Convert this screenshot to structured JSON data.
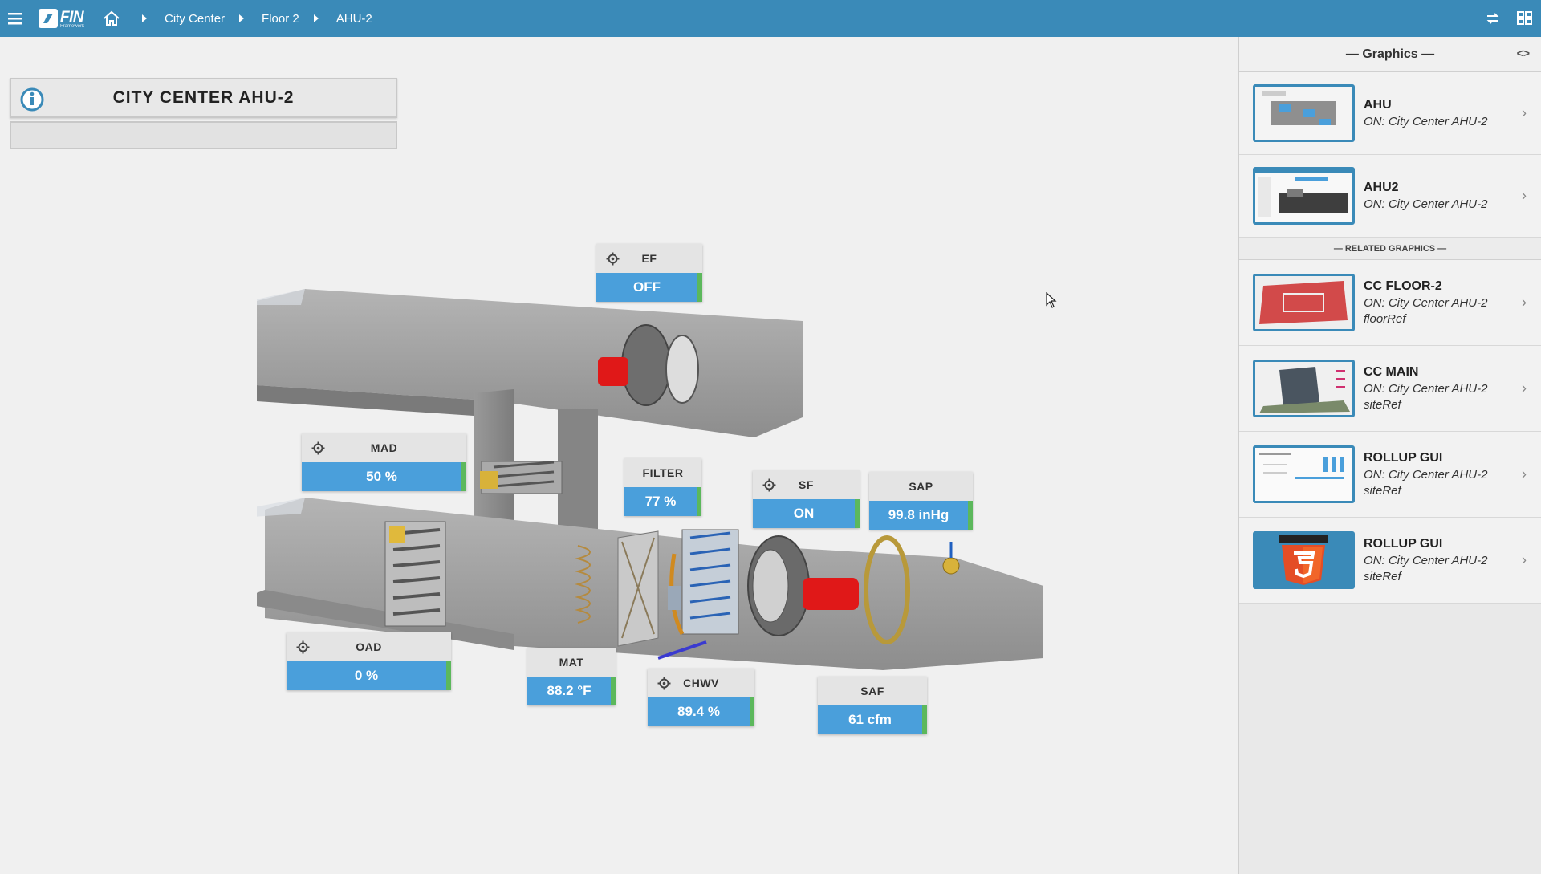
{
  "topbar": {
    "logo": "FIN",
    "logo_sub": "Framework",
    "breadcrumbs": [
      "City Center",
      "Floor 2",
      "AHU-2"
    ]
  },
  "header": {
    "title": "CITY CENTER AHU-2"
  },
  "points": {
    "ef": {
      "label": "EF",
      "value": "OFF"
    },
    "mad": {
      "label": "MAD",
      "value": "50 %"
    },
    "filter": {
      "label": "FILTER",
      "value": "77 %"
    },
    "sf": {
      "label": "SF",
      "value": "ON"
    },
    "sap": {
      "label": "SAP",
      "value": "99.8 inHg"
    },
    "oad": {
      "label": "OAD",
      "value": "0 %"
    },
    "mat": {
      "label": "MAT",
      "value": "88.2 °F"
    },
    "chwv": {
      "label": "CHWV",
      "value": "89.4 %"
    },
    "saf": {
      "label": "SAF",
      "value": "61 cfm"
    }
  },
  "sidebar": {
    "title": "— Graphics —",
    "toggle": "<>",
    "related_title": "— RELATED GRAPHICS —",
    "graphics": [
      {
        "name": "AHU",
        "on": "ON: City Center AHU-2"
      },
      {
        "name": "AHU2",
        "on": "ON: City Center AHU-2"
      }
    ],
    "related": [
      {
        "name": "CC FLOOR-2",
        "on": "ON: City Center AHU-2",
        "ref": "floorRef"
      },
      {
        "name": "CC MAIN",
        "on": "ON: City Center AHU-2",
        "ref": "siteRef"
      },
      {
        "name": "ROLLUP GUI",
        "on": "ON: City Center AHU-2",
        "ref": "siteRef"
      },
      {
        "name": "ROLLUP GUI",
        "on": "ON: City Center AHU-2",
        "ref": "siteRef"
      }
    ],
    "html5_badge": "HTML"
  },
  "colors": {
    "topbar": "#3a8ab8",
    "value_bg": "#4a9fdb",
    "status_ok": "#5cb85c",
    "fan_red": "#e01818"
  }
}
